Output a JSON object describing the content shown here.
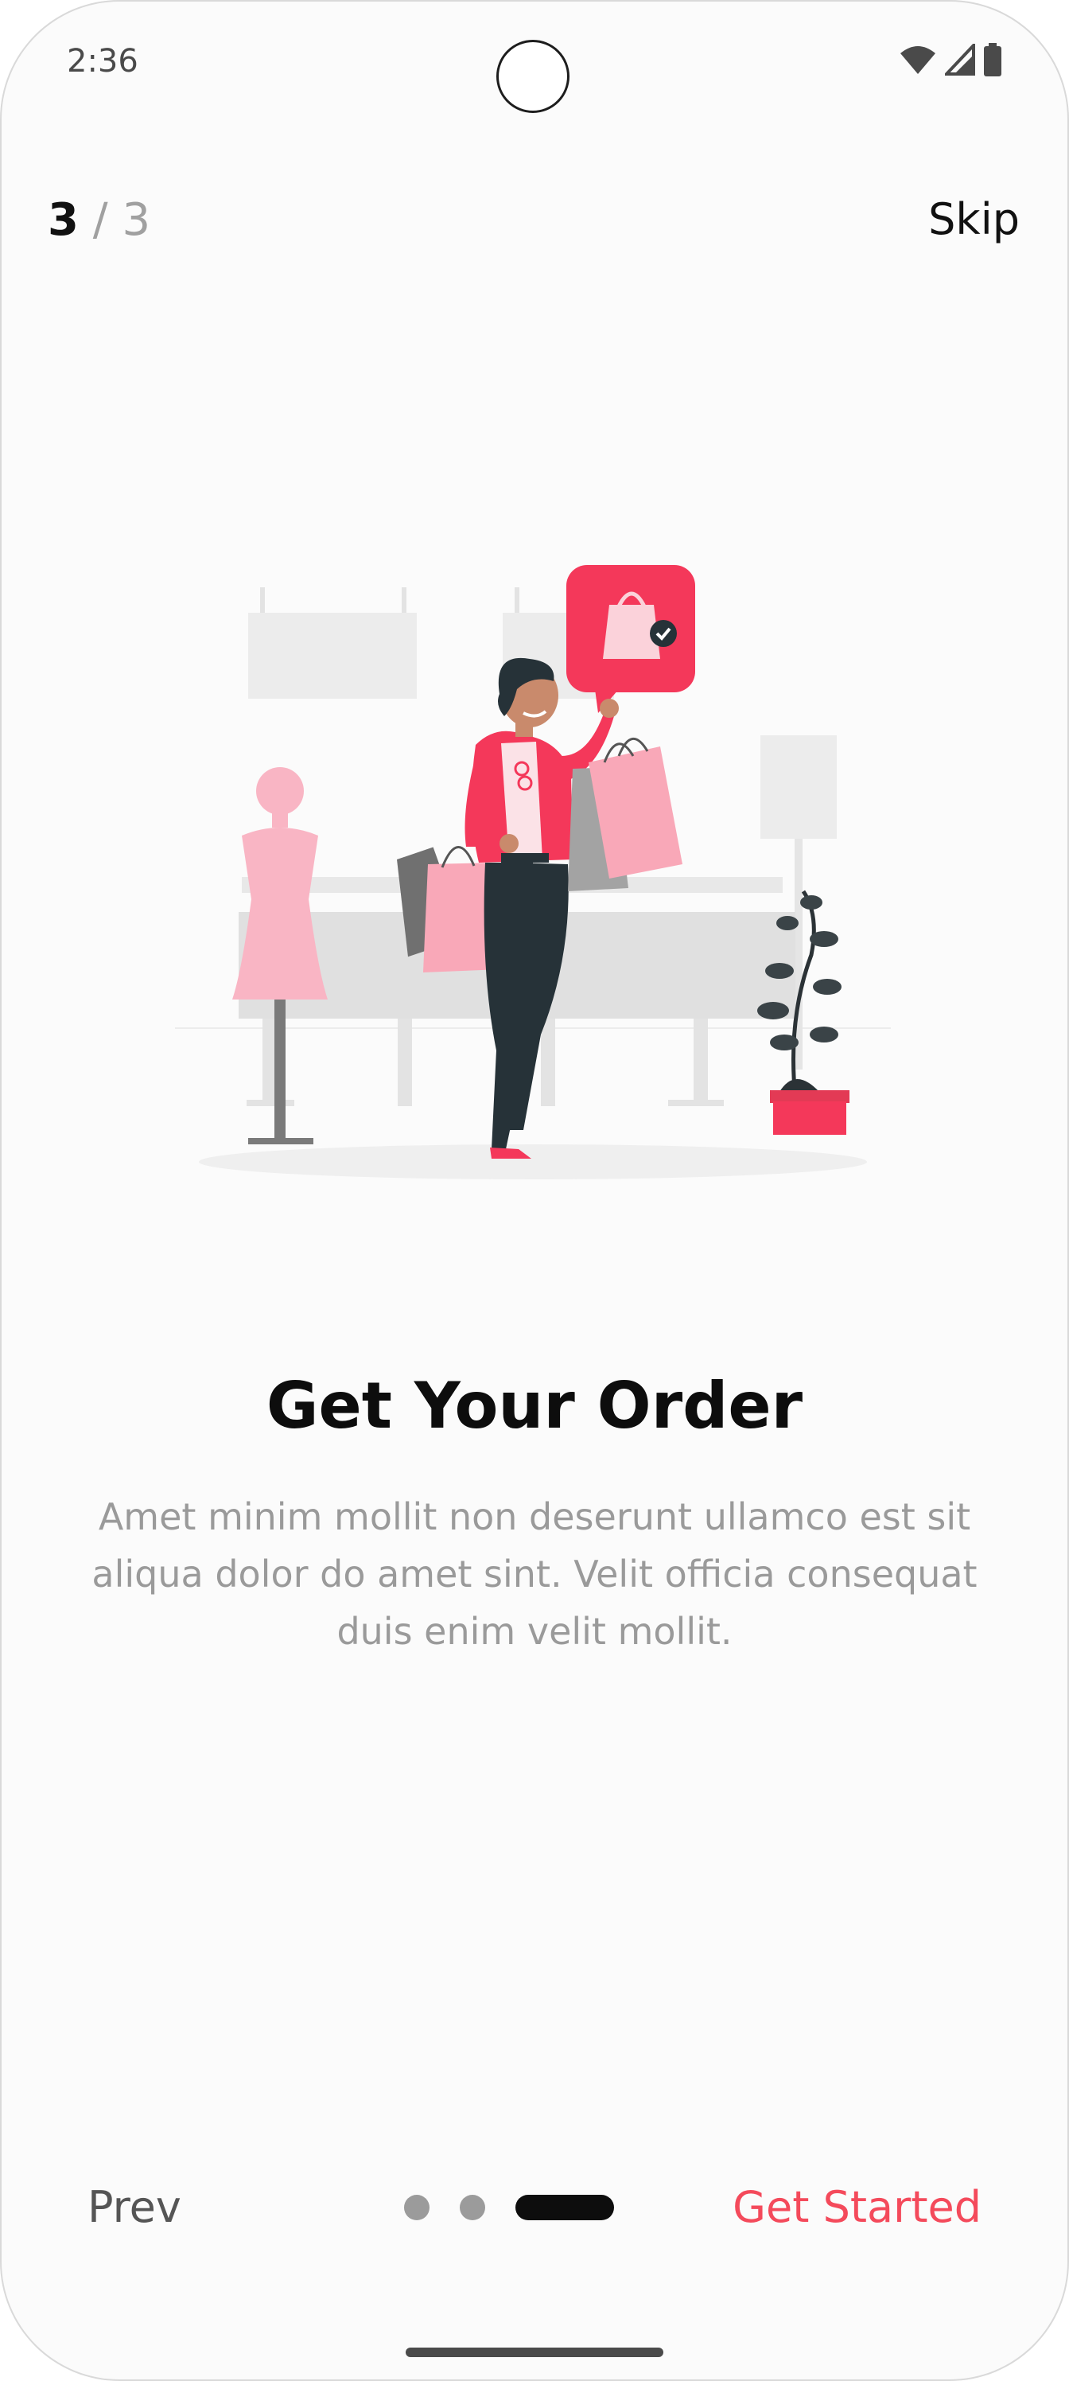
{
  "status_bar": {
    "time": "2:36",
    "icons": [
      "wifi-icon",
      "signal-icon",
      "battery-icon"
    ]
  },
  "pager": {
    "current": "3",
    "separator": "/",
    "total": "3"
  },
  "header": {
    "skip_label": "Skip"
  },
  "onboarding": {
    "illustration": "woman-shopping-illustration",
    "title": "Get Your Order",
    "description": "Amet minim mollit non deserunt ullamco est sit aliqua dolor do amet sint. Velit officia consequat duis enim velit mollit."
  },
  "footer": {
    "prev_label": "Prev",
    "get_started_label": "Get Started",
    "page_count": 3,
    "active_page": 3
  },
  "colors": {
    "accent": "#f44a5b",
    "illustration_red": "#f4385a",
    "illustration_pink": "#f9a8b8",
    "text_primary": "#0d0d0d",
    "text_secondary": "#9a9a9a"
  }
}
